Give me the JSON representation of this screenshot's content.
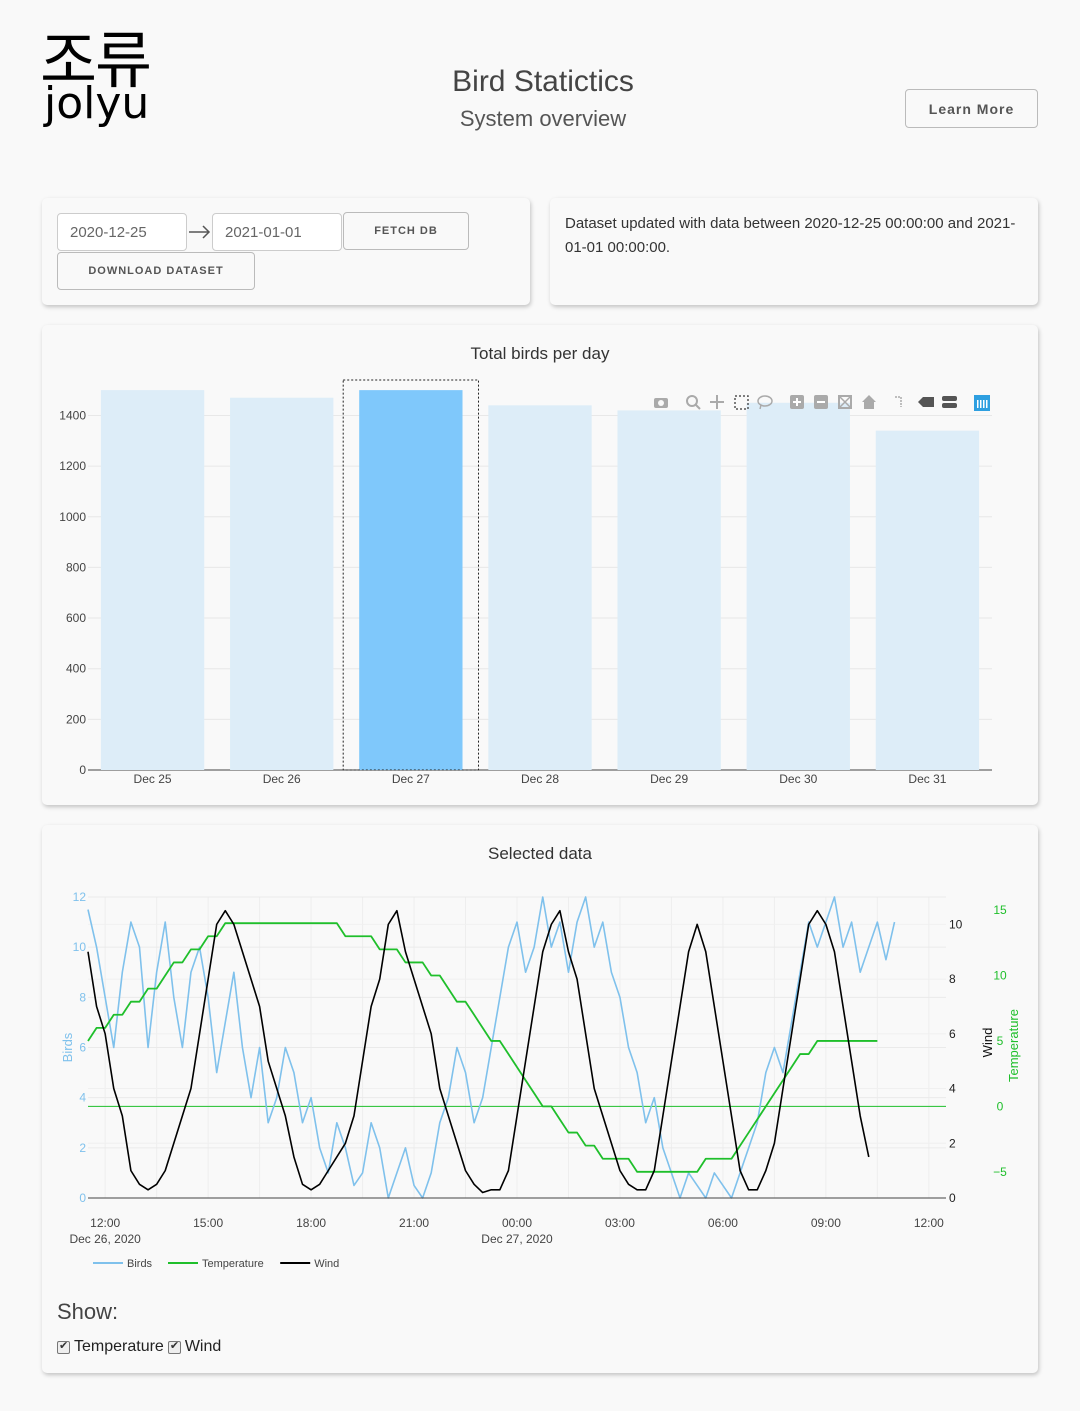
{
  "logo": {
    "korean": "조류",
    "latin": "jolyu"
  },
  "header": {
    "title": "Bird Statictics",
    "subtitle": "System overview",
    "learn_more": "Learn More"
  },
  "controls": {
    "start_date": "2020-12-25",
    "end_date": "2021-01-01",
    "fetch_label": "FETCH DB",
    "download_label": "DOWNLOAD DATASET"
  },
  "info": {
    "message": "Dataset updated with data between 2020-12-25 00:00:00 and 2021-01-01 00:00:00."
  },
  "colors": {
    "birds": "#7fc1ec",
    "temperature": "#1fbf2b",
    "wind": "#000000",
    "bar_selected": "#7fc8fb",
    "bar_unselected": "#ddedf8",
    "modebar_active": "#2e9fe0"
  },
  "modebar": {
    "icons": [
      "camera-icon",
      "zoom-icon",
      "pan-icon",
      "box-select-icon",
      "lasso-icon",
      "zoom-in-icon",
      "zoom-out-icon",
      "autoscale-icon",
      "reset-axes-icon",
      "spike-lines-icon",
      "hover-closest-icon",
      "hover-compare-icon",
      "plotly-logo-icon"
    ]
  },
  "chart_data": [
    {
      "type": "bar",
      "title": "Total birds per day",
      "categories": [
        "Dec 25",
        "Dec 26",
        "Dec 27",
        "Dec 28",
        "Dec 29",
        "Dec 30",
        "Dec 31"
      ],
      "values": [
        1500,
        1470,
        1500,
        1440,
        1420,
        1450,
        1340
      ],
      "selected_index": 2,
      "ylim": [
        0,
        1540
      ],
      "yticks": [
        0,
        200,
        400,
        600,
        800,
        1000,
        1200,
        1400
      ],
      "grid": true
    },
    {
      "type": "line",
      "title": "Selected data",
      "x_range": [
        "2020-12-26 11:30",
        "2020-12-27 12:30"
      ],
      "x_ticks": [
        {
          "label": "12:00",
          "sub": "Dec 26, 2020"
        },
        {
          "label": "15:00",
          "sub": ""
        },
        {
          "label": "18:00",
          "sub": ""
        },
        {
          "label": "21:00",
          "sub": ""
        },
        {
          "label": "00:00",
          "sub": "Dec 27, 2020"
        },
        {
          "label": "03:00",
          "sub": ""
        },
        {
          "label": "06:00",
          "sub": ""
        },
        {
          "label": "09:00",
          "sub": ""
        },
        {
          "label": "12:00",
          "sub": ""
        }
      ],
      "axes": {
        "birds": {
          "label": "Birds",
          "range": [
            0,
            12
          ],
          "ticks": [
            0,
            2,
            4,
            6,
            8,
            10,
            12
          ]
        },
        "wind": {
          "label": "Wind",
          "range": [
            0,
            11
          ],
          "ticks": [
            0,
            2,
            4,
            6,
            8,
            10
          ]
        },
        "temperature": {
          "label": "Temperature",
          "range": [
            -7,
            16
          ],
          "ticks": [
            -5,
            0,
            5,
            10,
            15
          ]
        }
      },
      "series": [
        {
          "name": "Birds",
          "axis": "birds",
          "values": [
            11.5,
            10,
            8,
            6,
            9,
            11,
            10,
            6,
            9,
            11,
            8,
            6,
            9,
            10,
            8,
            5,
            7,
            9,
            6,
            4,
            6,
            3,
            4,
            6,
            5,
            3,
            4,
            2,
            1,
            3,
            2,
            0.5,
            1,
            3,
            2,
            0,
            1,
            2,
            0.5,
            0,
            1,
            3,
            4,
            6,
            5,
            3,
            4,
            6,
            8,
            10,
            11,
            9,
            10,
            12,
            10,
            11,
            9,
            11,
            12,
            10,
            11,
            9,
            8,
            6,
            5,
            3,
            4,
            2,
            1,
            0,
            1,
            0.5,
            0,
            1,
            0.5,
            0,
            1,
            2,
            3,
            5,
            6,
            5,
            7,
            9,
            11,
            10,
            11,
            12,
            10,
            11,
            9,
            10,
            11,
            9.5,
            11
          ],
          "x_start": 0,
          "x_step": 0.25
        },
        {
          "name": "Temperature",
          "axis": "temperature",
          "values": [
            5,
            6,
            6,
            7,
            7,
            8,
            8,
            9,
            9,
            10,
            11,
            11,
            12,
            12,
            13,
            13,
            14,
            14,
            14,
            14,
            14,
            14,
            14,
            14,
            14,
            14,
            14,
            14,
            14,
            14,
            13,
            13,
            13,
            13,
            12,
            12,
            12,
            11,
            11,
            11,
            10,
            10,
            9,
            8,
            8,
            7,
            6,
            5,
            5,
            4,
            3,
            2,
            1,
            0,
            0,
            -1,
            -2,
            -2,
            -3,
            -3,
            -4,
            -4,
            -4,
            -4,
            -5,
            -5,
            -5,
            -5,
            -5,
            -5,
            -5,
            -5,
            -4,
            -4,
            -4,
            -4,
            -3,
            -2,
            -1,
            0,
            1,
            2,
            3,
            4,
            4,
            5,
            5,
            5,
            5,
            5,
            5,
            5,
            5
          ],
          "x_start": 0,
          "x_step": 0.25
        },
        {
          "name": "Wind",
          "axis": "wind",
          "values": [
            9,
            7,
            6,
            4,
            3,
            1,
            0.5,
            0.3,
            0.5,
            1,
            2,
            3,
            4,
            6,
            8,
            10,
            10.5,
            10,
            9,
            8,
            7,
            5,
            4,
            3,
            1.5,
            0.5,
            0.3,
            0.5,
            1,
            1.5,
            2,
            3,
            5,
            7,
            8,
            10,
            10.5,
            9,
            8,
            7,
            6,
            4,
            3,
            2,
            1,
            0.5,
            0.2,
            0.3,
            0.3,
            1,
            3,
            5,
            7,
            9,
            10,
            10.5,
            9,
            8,
            6,
            4,
            3,
            2,
            1,
            0.5,
            0.3,
            0.3,
            1,
            3,
            5,
            7,
            9,
            10,
            9,
            7,
            5,
            3,
            1,
            0.3,
            0.3,
            1,
            2,
            4,
            6,
            8,
            10,
            10.5,
            10,
            9,
            7,
            5,
            3,
            1.5
          ],
          "x_start": 0,
          "x_step": 0.25
        }
      ],
      "reference_line": {
        "axis": "temperature",
        "value": 0
      },
      "legend": [
        "Birds",
        "Temperature",
        "Wind"
      ],
      "legend_position": "bottom-left"
    }
  ],
  "show": {
    "label": "Show:",
    "options": [
      {
        "label": "Temperature",
        "checked": true
      },
      {
        "label": "Wind",
        "checked": true
      }
    ]
  }
}
